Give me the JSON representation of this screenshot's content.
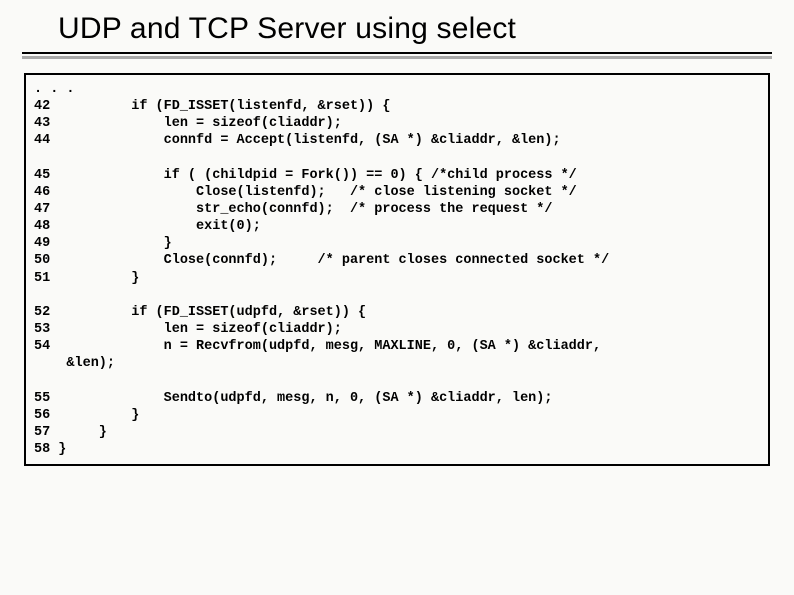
{
  "title": "UDP and TCP Server using select",
  "code": ". . .\n42          if (FD_ISSET(listenfd, &rset)) {\n43              len = sizeof(cliaddr);\n44              connfd = Accept(listenfd, (SA *) &cliaddr, &len);\n\n45              if ( (childpid = Fork()) == 0) { /*child process */\n46                  Close(listenfd);   /* close listening socket */\n47                  str_echo(connfd);  /* process the request */\n48                  exit(0);\n49              }\n50              Close(connfd);     /* parent closes connected socket */\n51          }\n\n52          if (FD_ISSET(udpfd, &rset)) {\n53              len = sizeof(cliaddr);\n54              n = Recvfrom(udpfd, mesg, MAXLINE, 0, (SA *) &cliaddr,\n    &len);\n\n55              Sendto(udpfd, mesg, n, 0, (SA *) &cliaddr, len);\n56          }\n57      }\n58 }"
}
